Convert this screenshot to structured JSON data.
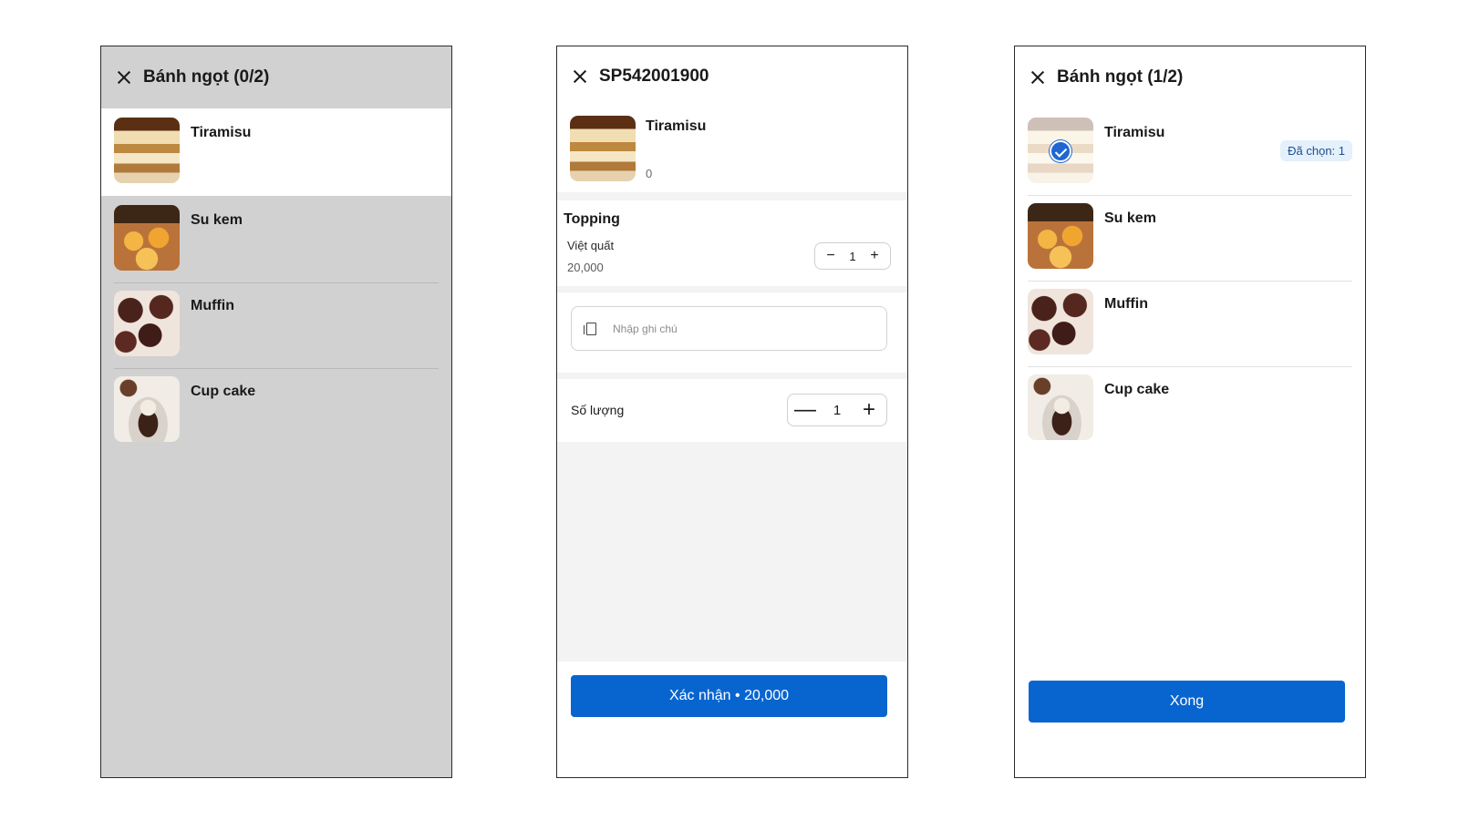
{
  "screen1": {
    "title": "Bánh ngọt (0/2)",
    "items": [
      {
        "name": "Tiramisu"
      },
      {
        "name": "Su kem"
      },
      {
        "name": "Muffin"
      },
      {
        "name": "Cup cake"
      }
    ]
  },
  "screen2": {
    "title": "SP542001900",
    "product": {
      "name": "Tiramisu",
      "price": "0"
    },
    "topping": {
      "title": "Topping",
      "name": "Việt quất",
      "price": "20,000",
      "quantity": "1",
      "minus": "−",
      "plus": "+"
    },
    "note": {
      "placeholder": "Nhập ghi chú"
    },
    "quantity": {
      "label": "Số lượng",
      "value": "1",
      "minus": "—",
      "plus": "+"
    },
    "confirm_label": "Xác nhận • 20,000"
  },
  "screen3": {
    "title": "Bánh ngọt (1/2)",
    "items": [
      {
        "name": "Tiramisu",
        "badge": "Đã chọn: 1",
        "selected": true
      },
      {
        "name": "Su kem"
      },
      {
        "name": "Muffin"
      },
      {
        "name": "Cup cake"
      }
    ],
    "done_label": "Xong"
  },
  "colors": {
    "primary": "#0865d0",
    "overlay": "#d1d1d1",
    "badge_bg": "#e4f0fb"
  },
  "icons": [
    "close-icon",
    "check-icon",
    "note-icon"
  ]
}
